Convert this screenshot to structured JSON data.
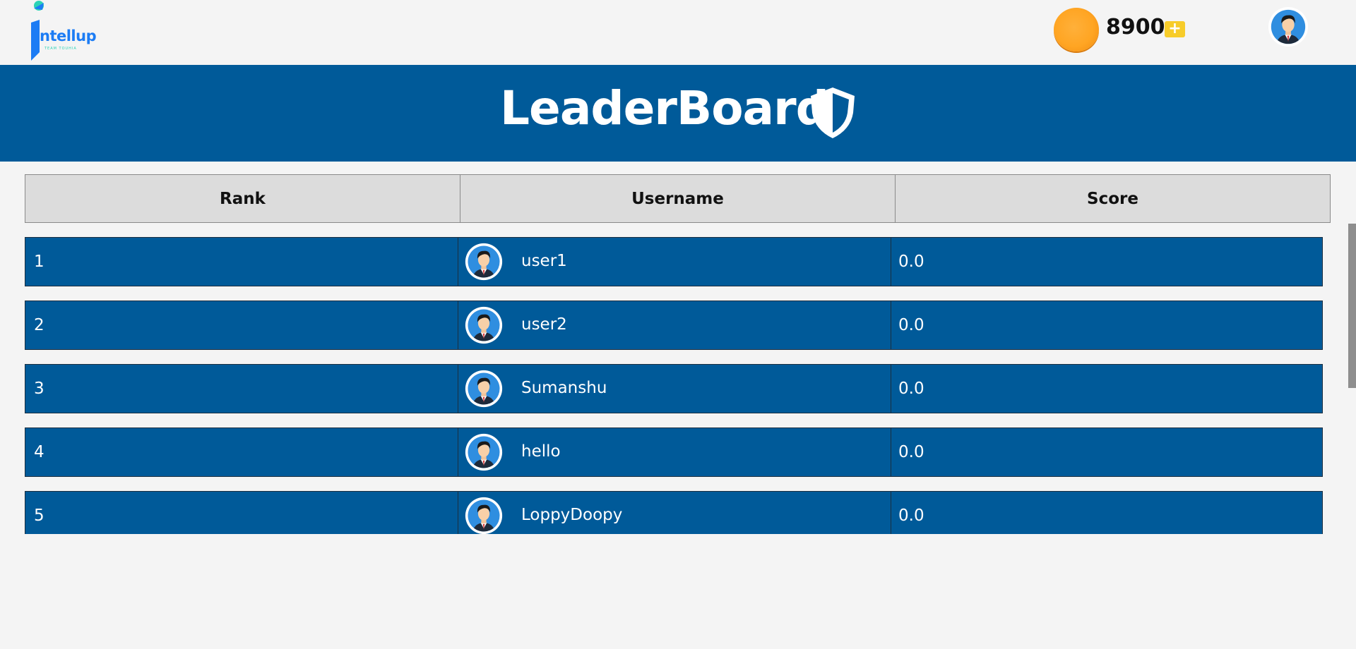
{
  "brand": {
    "name": "ntellup",
    "tagline": "TEAM TOUHIA"
  },
  "wallet": {
    "coins": "8900",
    "add_label": "+"
  },
  "page": {
    "title": "LeaderBoard"
  },
  "table": {
    "headers": [
      "Rank",
      "Username",
      "Score"
    ],
    "rows": [
      {
        "rank": "1",
        "username": "user1",
        "score": "0.0"
      },
      {
        "rank": "2",
        "username": "user2",
        "score": "0.0"
      },
      {
        "rank": "3",
        "username": "Sumanshu",
        "score": "0.0"
      },
      {
        "rank": "4",
        "username": "hello",
        "score": "0.0"
      },
      {
        "rank": "5",
        "username": "LoppyDoopy",
        "score": "0.0"
      }
    ]
  },
  "colors": {
    "primary": "#005a99",
    "coin": "#ffa523",
    "plus": "#f7cc2a",
    "header_bg": "#dcdcdc"
  },
  "icons": [
    "logo-icon",
    "coin-icon",
    "plus-icon",
    "avatar-icon",
    "shield-icon"
  ]
}
